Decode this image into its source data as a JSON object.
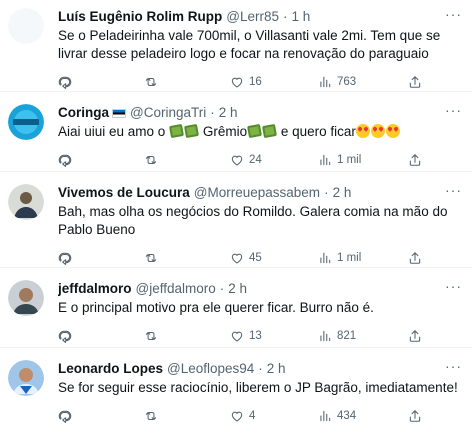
{
  "tweets": [
    {
      "name": "Luís Eugênio Rolim Rupp",
      "handle": "@Lerr85",
      "time": "1 h",
      "text": "Se o Peladeirinha vale 700mil, o Villasanti vale 2mi. Tem que se livrar desse peladeiro logo e focar na renovação do paraguaio",
      "replies": "",
      "retweets": "",
      "likes": "16",
      "views": "763"
    },
    {
      "name": "Coringa",
      "handle": "@CoringaTri",
      "time": "2 h",
      "text_a": "Aiai uiui eu amo o ",
      "text_b": "Grêmio",
      "text_c": " e quero ficar",
      "replies": "",
      "retweets": "",
      "likes": "24",
      "views": "1 mil"
    },
    {
      "name": "Vivemos de Loucura",
      "handle": "@Morreuepassabem",
      "time": "2 h",
      "text": "Bah, mas olha os negócios do Romildo. Galera comia na mão do Pablo Bueno",
      "replies": "",
      "retweets": "",
      "likes": "45",
      "views": "1 mil"
    },
    {
      "name": "jeffdalmoro",
      "handle": "@jeffdalmoro",
      "time": "2 h",
      "text": "E o principal motivo pra ele querer ficar. Burro não é.",
      "replies": "",
      "retweets": "",
      "likes": "13",
      "views": "821"
    },
    {
      "name": "Leonardo Lopes",
      "handle": "@Leoflopes94",
      "time": "2 h",
      "text": "Se for seguir esse raciocínio, liberem o JP Bagrão, imediatamente!",
      "replies": "",
      "retweets": "",
      "likes": "4",
      "views": "434"
    }
  ],
  "ui": {
    "dot": "·",
    "more": "···",
    "accent": "#1d9bf0",
    "muted": "#536471"
  },
  "icons": [
    "reply-icon",
    "retweet-icon",
    "like-icon",
    "views-icon",
    "share-icon",
    "more-icon"
  ]
}
